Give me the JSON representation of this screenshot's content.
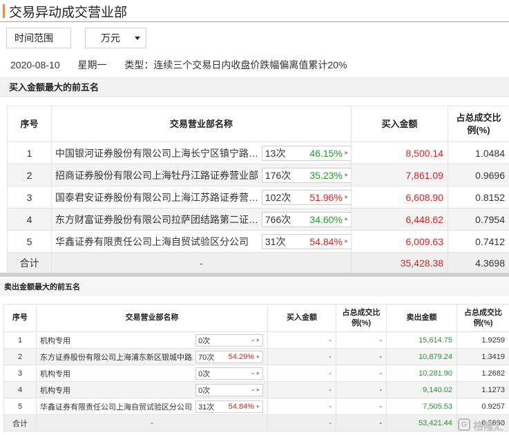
{
  "page": {
    "title": "交易异动成交营业部"
  },
  "controls": {
    "range_label": "时间范围",
    "unit_label": "万元"
  },
  "meta": {
    "date": "2020-08-10",
    "weekday": "星期一",
    "type": "类型：连续三个交易日内收盘价跌幅偏离值累计20%"
  },
  "buy": {
    "section_title": "买入金额最大的前五名",
    "headers": {
      "idx": "序号",
      "name": "交易营业部名称",
      "amount": "买入金额",
      "ratio": "占总成交比例(%)"
    },
    "rows": [
      {
        "idx": "1",
        "name": "中国银河证券股份有限公司上海长宁区镇宁路…",
        "count": "13次",
        "pct": "46.15%",
        "amount": "8,500.14",
        "ratio": "1.0484"
      },
      {
        "idx": "2",
        "name": "招商证券股份有限公司上海牡丹江路证券营业部",
        "count": "176次",
        "pct": "35.23%",
        "amount": "7,861.09",
        "ratio": "0.9696"
      },
      {
        "idx": "3",
        "name": "国泰君安证券股份有限公司上海江苏路证券营…",
        "count": "102次",
        "pct": "51.96%",
        "amount": "6,608.90",
        "ratio": "0.8152"
      },
      {
        "idx": "4",
        "name": "东方财富证券股份有限公司拉萨团结路第二证…",
        "count": "766次",
        "pct": "34.60%",
        "amount": "6,448.62",
        "ratio": "0.7954"
      },
      {
        "idx": "5",
        "name": "华鑫证券有限责任公司上海自贸试验区分公司",
        "count": "31次",
        "pct": "54.84%",
        "amount": "6,009.63",
        "ratio": "0.7412"
      }
    ],
    "total": {
      "label": "合计",
      "name": "-",
      "amount": "35,428.38",
      "ratio": "4.3698"
    }
  },
  "sell": {
    "section_title": "卖出金额最大的前五名",
    "headers": {
      "idx": "序号",
      "name": "交易营业部名称",
      "buy_amount": "买入金额",
      "buy_ratio": "占总成交比例(%)",
      "sell_amount": "卖出金额",
      "sell_ratio": "占总成交比例(%)"
    },
    "rows": [
      {
        "idx": "1",
        "name": "机构专用",
        "count": "0次",
        "pct": "-",
        "buy_amount": "-",
        "buy_ratio": "-",
        "sell_amount": "15,614.75",
        "sell_ratio": "1.9259"
      },
      {
        "idx": "2",
        "name": "东方证券股份有限公司上海浦东新区银城中路…",
        "count": "70次",
        "pct": "54.29%",
        "buy_amount": "-",
        "buy_ratio": "-",
        "sell_amount": "10,879.24",
        "sell_ratio": "1.3419"
      },
      {
        "idx": "3",
        "name": "机构专用",
        "count": "0次",
        "pct": "-",
        "buy_amount": "-",
        "buy_ratio": "-",
        "sell_amount": "10,281.90",
        "sell_ratio": "1.2682"
      },
      {
        "idx": "4",
        "name": "机构专用",
        "count": "0次",
        "pct": "-",
        "buy_amount": "-",
        "buy_ratio": "-",
        "sell_amount": "9,140.02",
        "sell_ratio": "1.1273"
      },
      {
        "idx": "5",
        "name": "华鑫证券有限责任公司上海自贸试验区分公司",
        "count": "31次",
        "pct": "54.84%",
        "buy_amount": "-",
        "buy_ratio": "-",
        "sell_amount": "7,505.53",
        "sell_ratio": "0.9257"
      }
    ],
    "total": {
      "label": "合计",
      "name": "-",
      "buy_amount": "-",
      "buy_ratio": "-",
      "sell_amount": "53,421.44",
      "sell_ratio": "6.5890"
    }
  },
  "badge_arrow": "▸",
  "watermark": {
    "logo_letter": "G",
    "text": "格隆汇"
  },
  "colors": {
    "accent": "#f08a3c",
    "red": "#e0211c",
    "green": "#1f9d2b"
  }
}
